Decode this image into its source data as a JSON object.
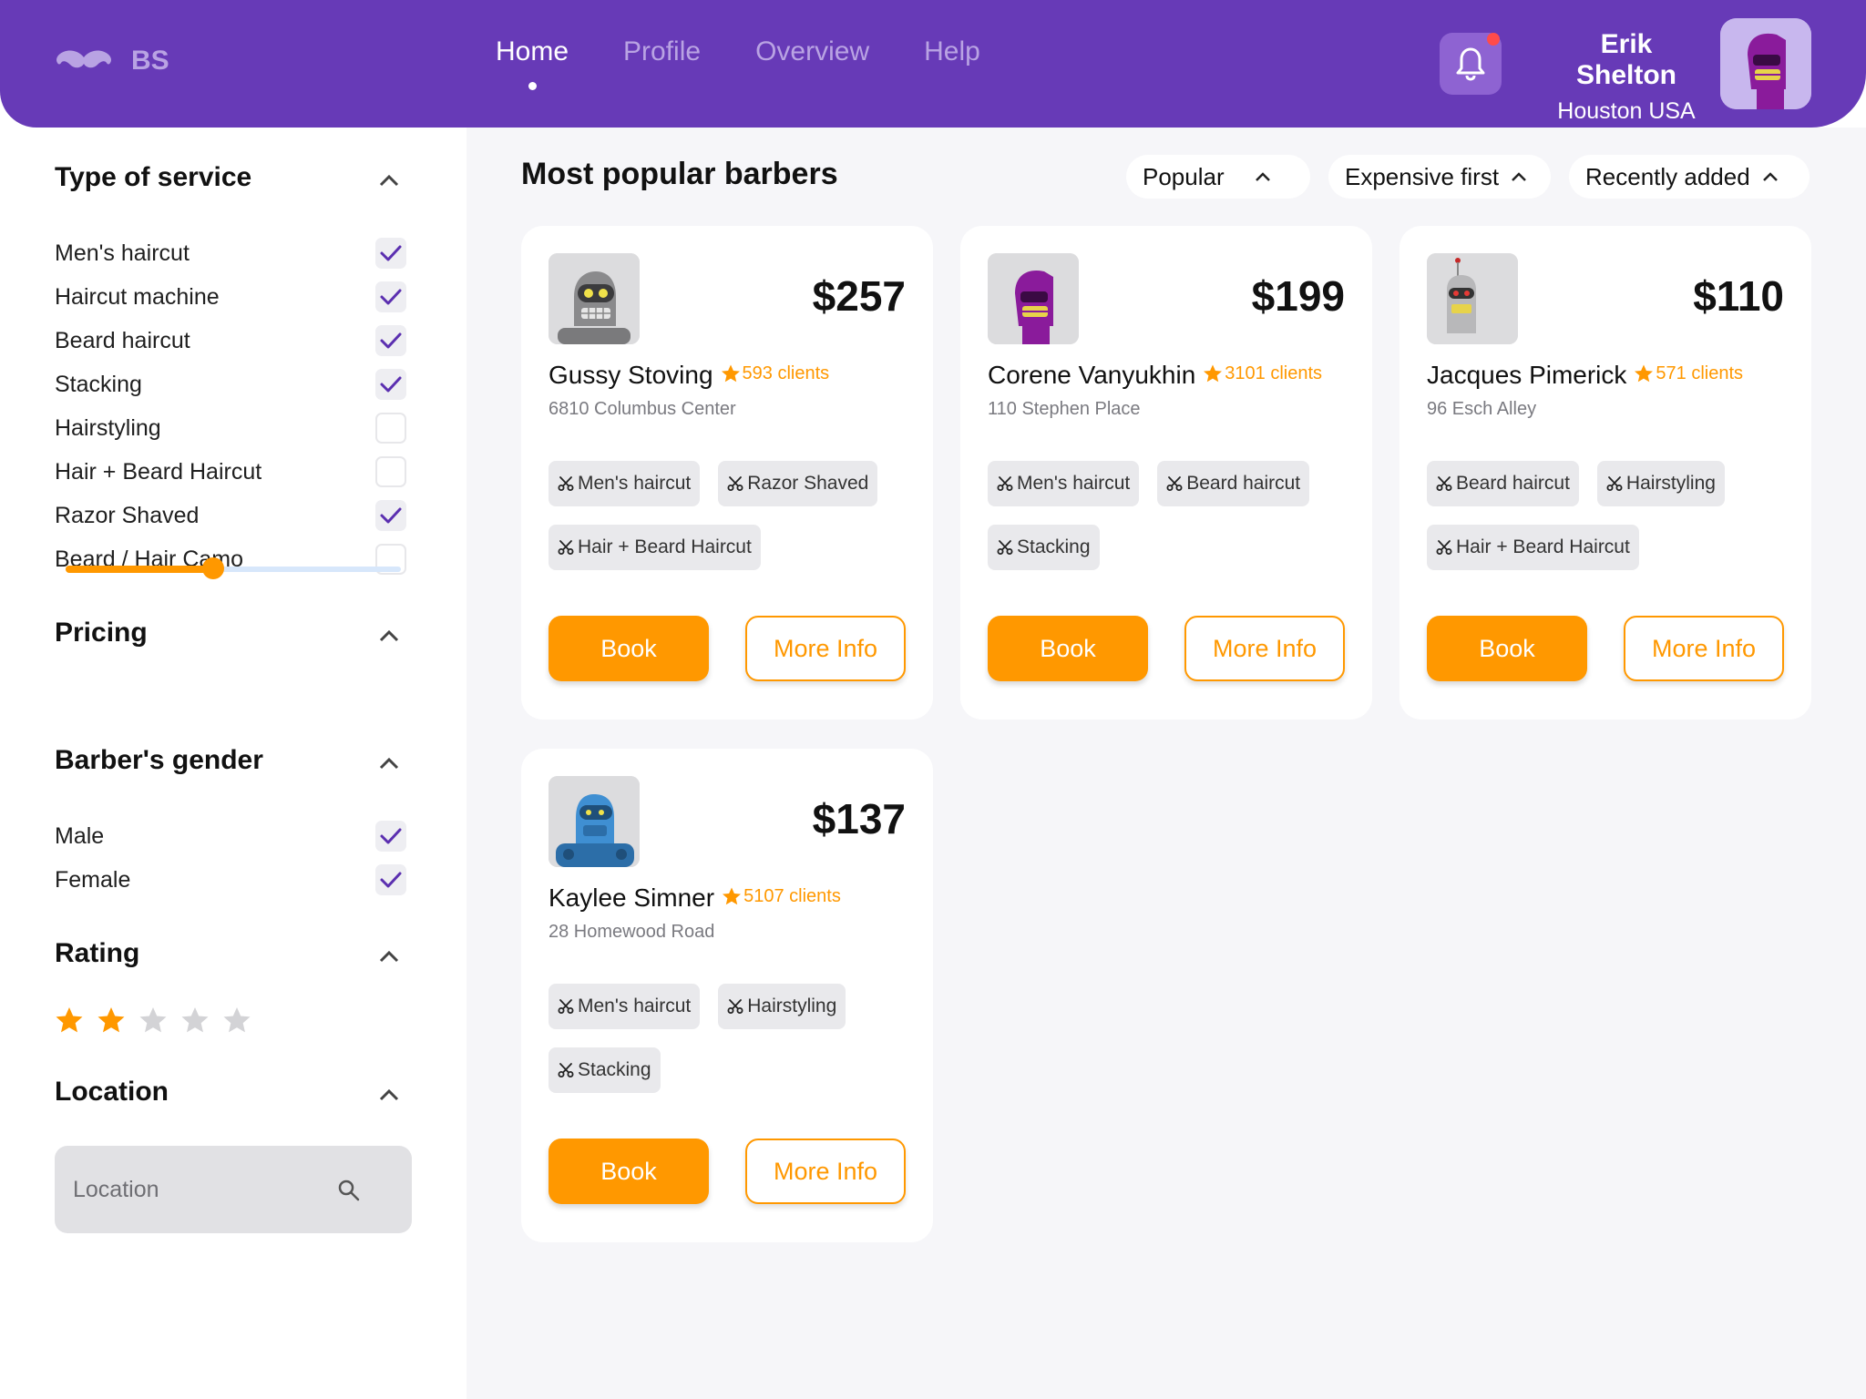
{
  "brand": {
    "logo_icon": "mustache-icon",
    "text": "BS"
  },
  "nav": {
    "items": [
      {
        "label": "Home",
        "active": true
      },
      {
        "label": "Profile",
        "active": false
      },
      {
        "label": "Overview",
        "active": false
      },
      {
        "label": "Help",
        "active": false
      }
    ]
  },
  "user": {
    "name": "Erik Shelton",
    "location": "Houston USA",
    "has_notification": true
  },
  "sidebar": {
    "service": {
      "title": "Type of service",
      "items": [
        {
          "label": "Men's haircut",
          "checked": true
        },
        {
          "label": "Haircut machine",
          "checked": true
        },
        {
          "label": "Beard haircut",
          "checked": true
        },
        {
          "label": "Stacking",
          "checked": true
        },
        {
          "label": "Hairstyling",
          "checked": false
        },
        {
          "label": "Hair + Beard Haircut",
          "checked": false
        },
        {
          "label": "Razor Shaved",
          "checked": true
        },
        {
          "label": "Beard / Hair Camo",
          "checked": false
        }
      ]
    },
    "pricing": {
      "title": "Pricing",
      "slider_value": 0.44
    },
    "gender": {
      "title": "Barber's gender",
      "items": [
        {
          "label": "Male",
          "checked": true
        },
        {
          "label": "Female",
          "checked": true
        }
      ]
    },
    "rating": {
      "title": "Rating",
      "value": 2,
      "max": 5
    },
    "location": {
      "title": "Location",
      "placeholder": "Location"
    }
  },
  "main": {
    "title": "Most popular barbers",
    "sort": [
      {
        "label": "Popular"
      },
      {
        "label": "Expensive first"
      },
      {
        "label": "Recently added"
      }
    ],
    "book_label": "Book",
    "more_label": "More Info",
    "barbers": [
      {
        "name": "Gussy Stoving",
        "clients": "593 clients",
        "address": "6810 Columbus Center",
        "price": "$257",
        "avatar": "grey-robot",
        "tags": [
          "Men's haircut",
          "Razor Shaved",
          "Hair + Beard Haircut"
        ]
      },
      {
        "name": "Corene Vanyukhin",
        "clients": "3101 clients",
        "address": "110 Stephen Place",
        "price": "$199",
        "avatar": "purple-robot",
        "tags": [
          "Men's haircut",
          "Beard haircut",
          "Stacking"
        ]
      },
      {
        "name": "Jacques Pimerick",
        "clients": "571 clients",
        "address": "96 Esch Alley",
        "price": "$110",
        "avatar": "red-eye-robot",
        "tags": [
          "Beard haircut",
          "Hairstyling",
          "Hair + Beard Haircut"
        ]
      },
      {
        "name": "Kaylee Simner",
        "clients": "5107 clients",
        "address": "28 Homewood Road",
        "price": "$137",
        "avatar": "blue-robot",
        "tags": [
          "Men's haircut",
          "Hairstyling",
          "Stacking"
        ]
      }
    ]
  },
  "colors": {
    "brand": "#673ab7",
    "accent": "#ff9800",
    "background": "#f6f6f9"
  }
}
